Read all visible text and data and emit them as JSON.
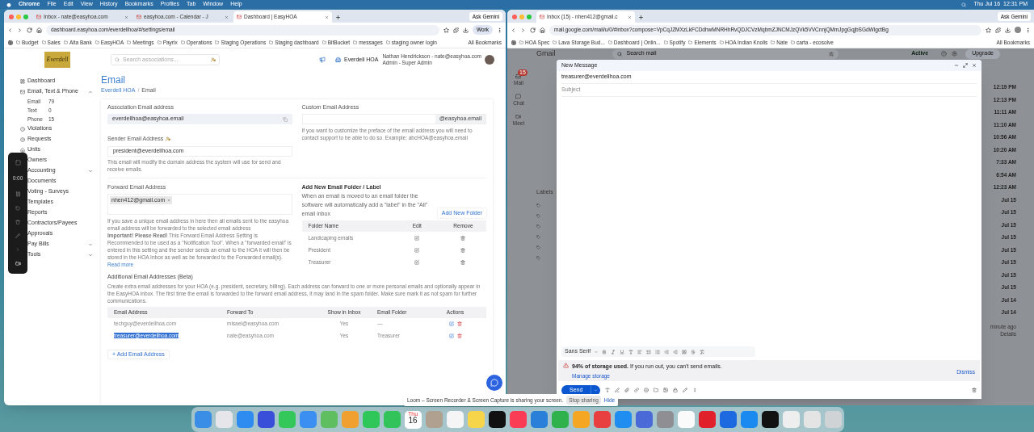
{
  "menu_bar": {
    "app": "Chrome",
    "items": [
      "File",
      "Edit",
      "View",
      "History",
      "Bookmarks",
      "Profiles",
      "Tab",
      "Window",
      "Help"
    ],
    "clock": "Thu Jul 16  12:31 PM"
  },
  "left_window": {
    "tabs": [
      {
        "label": "Inbox - nate@easyhoa.com",
        "selected": false
      },
      {
        "label": "easyhoa.com - Calendar - J",
        "selected": false
      },
      {
        "label": "Dashboard | EasyHOA",
        "selected": true
      }
    ],
    "ask_button": "Ask Gemini",
    "url": "dashboard.easyhoa.com/everdellhoa/#/settings/email",
    "profile": "Work",
    "bookmarks": [
      "Budget",
      "Sales",
      "Alta Bank",
      "EasyHOA",
      "Meetings",
      "Payrix",
      "Operations",
      "Staging Operations",
      "Staging dashboard",
      "BitBucket",
      "messages",
      "staging owner login"
    ],
    "all_bookmarks": "All Bookmarks",
    "app": {
      "logo": "Everdell",
      "search_placeholder": "Search associations...",
      "hoa": "Everdell HOA",
      "user": "Nathan Hendrickson - nate@easyhoa.com",
      "role": "Admin - Super Admin",
      "sidebar": [
        {
          "label": "Dashboard"
        },
        {
          "label": "Email, Text & Phone",
          "expanded": true,
          "children": [
            {
              "label": "Email",
              "count": "79"
            },
            {
              "label": "Text",
              "count": "0"
            },
            {
              "label": "Phone",
              "count": "15"
            }
          ]
        },
        {
          "label": "Violations"
        },
        {
          "label": "Requests"
        },
        {
          "label": "Units"
        },
        {
          "label": "Owners"
        },
        {
          "label": "Accounting",
          "expanded": false
        },
        {
          "label": "Documents"
        },
        {
          "label": "Voting - Surveys"
        },
        {
          "label": "Templates"
        },
        {
          "label": "Reports"
        },
        {
          "label": "Contractors/Payees"
        },
        {
          "label": "Approvals"
        },
        {
          "label": "Pay Bills",
          "expanded": false
        },
        {
          "label": "Tools",
          "expanded": false
        }
      ],
      "loom_timer": "0:00",
      "title": "Email",
      "breadcrumb": {
        "items": [
          "Everdell HOA",
          "Email"
        ],
        "separator": "/"
      },
      "association_email": {
        "label": "Association Email address",
        "value": "everdellhoa@easyhoa.email"
      },
      "custom_email": {
        "label": "Custom Email Address",
        "suffix": "@easyhoa.email",
        "help": "If you want to customize the preface of the email address you will need to contact support to be able to do so. Example: abcHOA@easyhoa.email"
      },
      "sender_email": {
        "label": "Sender Email Address",
        "value": "president@everdellhoa.com",
        "help": "This email will modify the domain address the system will use for send and receive emails."
      },
      "forward_email": {
        "label": "Forward Email Address",
        "chips": [
          "nhen412@gmail.com"
        ],
        "help": "If you save a unique email address in here then all emails sent to the easyhoa email address will be forwarded to the selected email address",
        "important": "**Important! Please Read!** This Forward Email Address Setting is Recommended to be used as a \"Notification Tool\". When a \"forwarded email\" is entered in this setting and the sender sends an email to the HOA it will then be stored in the HOA Inbox as well as be forwarded to the Forwarded email(s).",
        "read_more": "Read more"
      },
      "folders": {
        "title": "Add New Email Folder / Label",
        "description": "When an email is moved to an email folder the software will automatically add a \"label\" in the \"All\" email inbox",
        "add_button": "Add New Folder",
        "columns": [
          "Folder Name",
          "Edit",
          "Remove"
        ],
        "rows": [
          "Landicaping emails",
          "President",
          "Treasurer"
        ]
      },
      "additional": {
        "title": "Additional Email Addresses (Beta)",
        "description": "Create extra email addresses for your HOA (e.g. president, secretary, billing). Each address can forward to one or more personal emails and optionally appear in the EasyHOA inbox. The first time the email is forwarded to the forward email address, it may land in the spam folder. Make sure mark it as not spam for further communications.",
        "columns": [
          "Email Address",
          "Forward To",
          "Show in Inbox",
          "Email Folder",
          "Actions"
        ],
        "rows": [
          {
            "email": "techguy@everdellhoa.com",
            "forward_to": "misael@easyhoa.com",
            "show_in_inbox": "Yes",
            "folder": "—",
            "selected": false
          },
          {
            "email": "treasurer@everdellhoa.com",
            "forward_to": "nate@easyhoa.com",
            "show_in_inbox": "Yes",
            "folder": "Treasurer",
            "selected": true
          }
        ],
        "add_button": "+ Add Email Address"
      }
    }
  },
  "right_window": {
    "tabs": [
      {
        "label": "Inbox (15) - nhen412@gmail.c",
        "selected": true
      }
    ],
    "ask_button": "Ask Gemini",
    "url": "mail.google.com/mail/u/0/#inbox?compose=VpCqJZMXzLkFCDdhwMNRHhRvQDJCVzMqbmZJNCMJzQVk5VVCnnjQMmJpgGqjbSGdWlgctBg",
    "bookmarks": [
      "HOA Spec",
      "Lava Storage Bud...",
      "Dashboard | Onlin...",
      "Spotify",
      "Elements",
      "HOA Indian Knolls",
      "Nate",
      "carta - ecosolve"
    ],
    "all_bookmarks": "All Bookmarks",
    "gmail": {
      "logo": "Gmail",
      "search_placeholder": "Search mail",
      "status": "Active",
      "upgrade": "Upgrade",
      "rail": [
        {
          "label": "Mail",
          "badge": "15"
        },
        {
          "label": "Chat"
        },
        {
          "label": "Meet"
        }
      ],
      "labels_title": "Labels",
      "times": [
        "12:19 PM",
        "12:13 PM",
        "11:11 AM",
        "11:10 AM",
        "10:56 AM",
        "10:20 AM",
        "7:33 AM",
        "6:54 AM",
        "12:23 AM",
        "Jul 15",
        "Jul 15",
        "Jul 15",
        "Jul 15",
        "Jul 15",
        "Jul 15",
        "Jul 15",
        "Jul 15",
        "Jul 14",
        "Jul 14"
      ],
      "activity": "minute ago",
      "details": "Details"
    },
    "compose": {
      "title": "New Message",
      "to": "treasurer@everdellhoa.com",
      "subject_placeholder": "Subject",
      "font": "Sans Serif",
      "warning": "**94% of storage used.** If you run out, you can't send emails.",
      "manage": "Manage storage",
      "dismiss": "Dismiss",
      "send": "Send"
    }
  },
  "loom_banner": {
    "text": "Loom – Screen Recorder & Screen Capture is sharing your screen.",
    "stop": "Stop sharing",
    "hide": "Hide"
  },
  "dock": [
    {
      "kind": "app",
      "color": "#3a8ee6"
    },
    {
      "kind": "app",
      "color": "#e6e6ea"
    },
    {
      "kind": "app",
      "color": "#2e8cf0"
    },
    {
      "kind": "app",
      "color": "#3a4fd9"
    },
    {
      "kind": "app",
      "color": "#34c759"
    },
    {
      "kind": "app",
      "color": "#3b8ff0"
    },
    {
      "kind": "app",
      "color": "#5fbf60"
    },
    {
      "kind": "app",
      "color": "#f0a030"
    },
    {
      "kind": "app",
      "color": "#2fc65a"
    },
    {
      "kind": "app",
      "color": "#32c35a"
    },
    {
      "kind": "calendar",
      "color": "#ffffff",
      "weekday": "Thu",
      "day": "16"
    },
    {
      "kind": "app",
      "color": "#b0a090"
    },
    {
      "kind": "app",
      "color": "#f5f5f5"
    },
    {
      "kind": "app",
      "color": "#f7d54a"
    },
    {
      "kind": "app",
      "color": "#111111"
    },
    {
      "kind": "app",
      "color": "#fa3c55"
    },
    {
      "kind": "app",
      "color": "#2a7fd8"
    },
    {
      "kind": "app",
      "color": "#2fb24c"
    },
    {
      "kind": "app",
      "color": "#f5a623"
    },
    {
      "kind": "app",
      "color": "#e84040"
    },
    {
      "kind": "app",
      "color": "#1f8ef0"
    },
    {
      "kind": "app",
      "color": "#4a6ad8"
    },
    {
      "kind": "app",
      "color": "#8e8e93"
    },
    {
      "kind": "app",
      "color": "#fafafa"
    },
    {
      "kind": "app",
      "color": "#e0202a"
    },
    {
      "kind": "app",
      "color": "#1d6ae0"
    },
    {
      "kind": "app",
      "color": "#1a8af0"
    },
    {
      "kind": "app",
      "color": "#121212"
    },
    {
      "kind": "app",
      "color": "#eeeeee"
    },
    {
      "kind": "app",
      "color": "#e4e4e4"
    },
    {
      "kind": "app",
      "color": "#cfd3d6"
    }
  ]
}
